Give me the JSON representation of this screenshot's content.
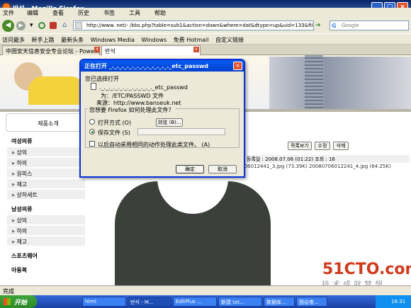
{
  "window": {
    "title": "반석 - Mozilla Firefox"
  },
  "menu": [
    "文件",
    "编辑",
    "查看",
    "历史",
    "书签",
    "工具",
    "帮助"
  ],
  "toolbar": {
    "url": "http://www.          net/- /bbs.php?table=sub1&action=down&where=dat&dtype=up&uid=133&file=",
    "search_placeholder": "Google"
  },
  "bookmarks": [
    "访问最多",
    "新手上路",
    "最新头条",
    "Windows Media",
    "Windows",
    "免费 Hotmail",
    "自定义链接"
  ],
  "tabs": [
    "中国安天信息安全专业论坛 - Powe...",
    "반석"
  ],
  "page": {
    "sidebar_title": "제품소개",
    "sections": [
      {
        "title": "여성의류",
        "items": [
          "상의",
          "하의",
          "원피스",
          "재고",
          "상하세트"
        ]
      },
      {
        "title": "남성의류",
        "items": [
          "상의",
          "하의",
          "재고"
        ]
      },
      {
        "title": "스포츠웨어",
        "items": []
      },
      {
        "title": "아동복",
        "items": []
      }
    ],
    "buttons": [
      "목록보기",
      "수정",
      "삭제"
    ],
    "meta": "등록일 : 2008.07.06 (01:22)   조회 : 16",
    "files": "20080706012441_3.jpg (73.39K)   20080706012241_4.jpg (64.25K)",
    "watermark_logo": "51CTO.com",
    "watermark_sub": "技术成就梦想"
  },
  "dialog": {
    "title": "正在打开 _._._._._._._._._._._._._etc_passwd",
    "opening": "您已选择打开",
    "filename": "._._._._._._._._._._._._etc_passwd",
    "type_line": "为：/ETC/PASSWD 文件",
    "from_line": "来源：http://www.banseuk.net",
    "question": "您想要 Firefox 如何处理此文件？",
    "open_with": "打开方式 (O)",
    "browse": "浏览 (B)...",
    "save_file": "保存文件 (S)",
    "auto_label": "以后自动采用相同的动作处理此类文件。 (A)",
    "ok": "确定",
    "cancel": "取消"
  },
  "status": {
    "text": "完成"
  },
  "taskbar": {
    "start": "开始",
    "items": [
      "html",
      "반석 - M...",
      "EditPlus ...",
      "新建 txt...",
      "数据库...",
      "图@查..."
    ],
    "clock": "16:31"
  }
}
